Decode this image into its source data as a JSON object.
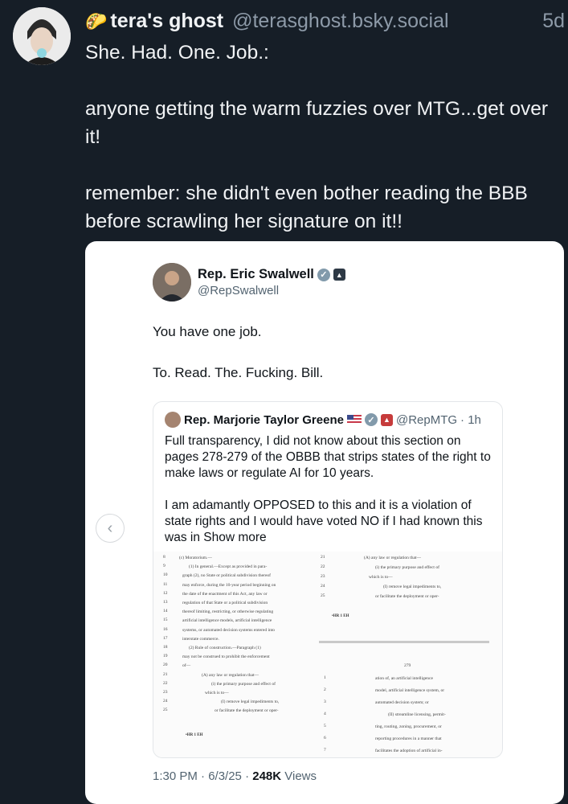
{
  "post": {
    "display_name": "tera's ghost",
    "handle": "@terasghost.bsky.social",
    "time": "5d",
    "taco_icon": "🌮",
    "text_lines": [
      "She. Had. One. Job.:",
      "",
      "anyone getting the warm fuzzies over MTG...get over it!",
      "",
      "remember:  she didn't even bother reading the BBB before scrawling her signature on it!!"
    ]
  },
  "embed": {
    "author_name": "Rep. Eric Swalwell",
    "author_handle": "@RepSwalwell",
    "line1": "You have one job.",
    "line2": "To. Read. The. Fucking. Bill.",
    "quote": {
      "name": "Rep. Marjorie Taylor Greene",
      "handle": "@RepMTG",
      "time": "· 1h",
      "para1": "Full transparency, I did not know about this section on pages 278-279 of the OBBB that strips states of the right to make laws or regulate AI for 10 years.",
      "para2": "I am adamantly OPPOSED to this and it is a violation of state rights and I would have voted NO if I had known this was in",
      "show_more": "Show more"
    },
    "meta_time": "1:30 PM · 6/3/25 · ",
    "meta_views_count": "248K",
    "meta_views_label": " Views",
    "nav_left_icon": "‹"
  },
  "doc": {
    "left_nums": [
      "8",
      "9",
      "10",
      "11",
      "12",
      "13",
      "14",
      "15",
      "16",
      "17",
      "18",
      "19",
      "20",
      "21",
      "22",
      "23",
      "24",
      "25"
    ],
    "left_lines": [
      "(c) Moratorium.—",
      "(1) In general.—Except as provided in para-",
      "graph (2), no State or political subdivision thereof",
      "may enforce, during the 10-year period beginning on",
      "the date of the enactment of this Act, any law or",
      "regulation of that State or a political subdivision",
      "thereof limiting, restricting, or otherwise regulating",
      "artificial intelligence models, artificial intelligence",
      "systems, or automated decision systems entered into",
      "interstate commerce.",
      "(2) Rule of construction.—Paragraph (1)",
      "may not be construed to prohibit the enforcement",
      "of—",
      "(A) any law or regulation that—",
      "(i) the primary purpose and effect of",
      "which is to—",
      "(I) remove legal impediments to,",
      "or facilitate the deployment or oper-"
    ],
    "right_top_nums": [
      "21",
      "22",
      "23",
      "24",
      "25"
    ],
    "right_top_lines": [
      "(A) any law or regulation that—",
      "(i) the primary purpose and effect of",
      "which is to—",
      "(I) remove legal impediments to,",
      "or facilitate the deployment or oper-"
    ],
    "page_num": "279",
    "right_bottom_nums": [
      "1",
      "2",
      "3",
      "4",
      "5",
      "6",
      "7"
    ],
    "right_bottom_lines": [
      "ation of, an artificial intelligence",
      "model, artificial intelligence system, or",
      "automated decision system; or",
      "(II) streamline licensing, permit-",
      "ting, routing, zoning, procurement, or",
      "reporting procedures in a manner that",
      "facilitates the adoption of artificial in-"
    ],
    "mark": "•HR 1 EH"
  }
}
